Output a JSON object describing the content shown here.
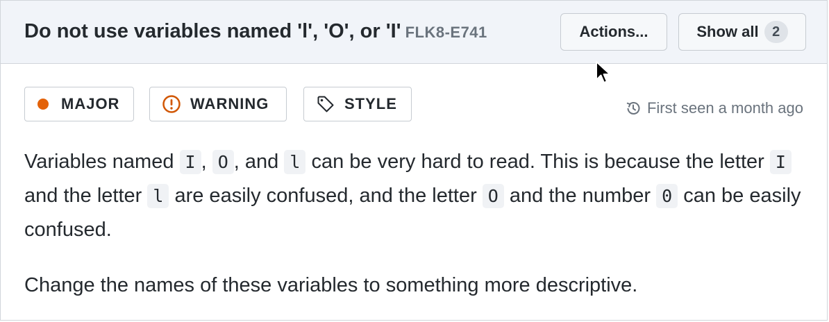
{
  "header": {
    "title": "Do not use variables named 'l', 'O', or 'I'",
    "issue_code": "FLK8-E741",
    "actions_label": "Actions...",
    "show_all_label": "Show all",
    "show_all_count": "2"
  },
  "tags": {
    "major": "MAJOR",
    "warning": "WARNING",
    "style": "STYLE"
  },
  "first_seen": "First seen a month ago",
  "description": {
    "p1_t1": "Variables named ",
    "code_I": "I",
    "p1_t2": ", ",
    "code_O": "O",
    "p1_t3": ", and ",
    "code_l": "l",
    "p1_t4": " can be very hard to read. This is because the letter ",
    "code_I2": "I",
    "p1_t5": " and the letter ",
    "code_l2": "l",
    "p1_t6": " are easily confused, and the letter ",
    "code_O2": "O",
    "p1_t7": " and the number ",
    "code_0": "0",
    "p1_t8": " can be easily confused.",
    "p2": "Change the names of these variables to something more descriptive."
  },
  "colors": {
    "major_dot": "#e36209",
    "warning_icon": "#d15704",
    "header_bg": "#f1f4f9"
  },
  "icons": [
    "warning-circle-icon",
    "tag-icon",
    "history-icon",
    "mouse-cursor-icon"
  ]
}
